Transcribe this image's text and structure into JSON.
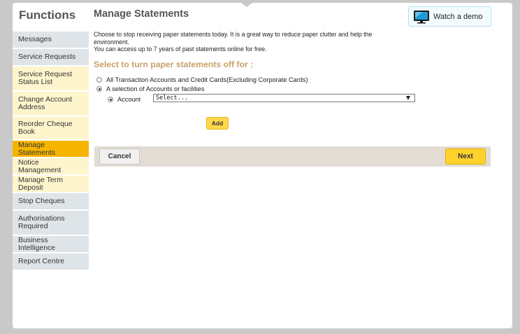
{
  "sidebar": {
    "title": "Functions",
    "items": [
      {
        "label": "Messages"
      },
      {
        "label": "Service Requests"
      },
      {
        "label": "Service Request Status List"
      },
      {
        "label": "Change Account Address"
      },
      {
        "label": "Reorder Cheque Book"
      },
      {
        "label": "Manage Statements"
      },
      {
        "label": "Notice Management"
      },
      {
        "label": "Manage Term Deposit"
      },
      {
        "label": "Stop Cheques"
      },
      {
        "label": "Authorisations Required"
      },
      {
        "label": "Business Intelligence"
      },
      {
        "label": "Report Centre"
      }
    ]
  },
  "main": {
    "title": "Manage Statements",
    "demo_label": "Watch a demo",
    "intro_line1": "Choose to stop receiving paper statements today. It is a great way to reduce paper clutter and help the environment.",
    "intro_line2": "You can access up to 7 years of past statements online for free.",
    "section_heading": "Select to turn paper statements off for :",
    "option_all": "All Transaction Accounts and Credit Cards(Excluding Corporate Cards)",
    "option_selection": "A selection of Accounts or facilities",
    "account_label": "Account",
    "account_select_value": "Select...",
    "add_label": "Add",
    "cancel_label": "Cancel",
    "next_label": "Next"
  },
  "colors": {
    "active_nav": "#f5b400",
    "highlight_nav": "#fff5cc",
    "default_nav": "#dfe4e8",
    "section_heading": "#c8a06a",
    "primary_button": "#ffd22e"
  }
}
